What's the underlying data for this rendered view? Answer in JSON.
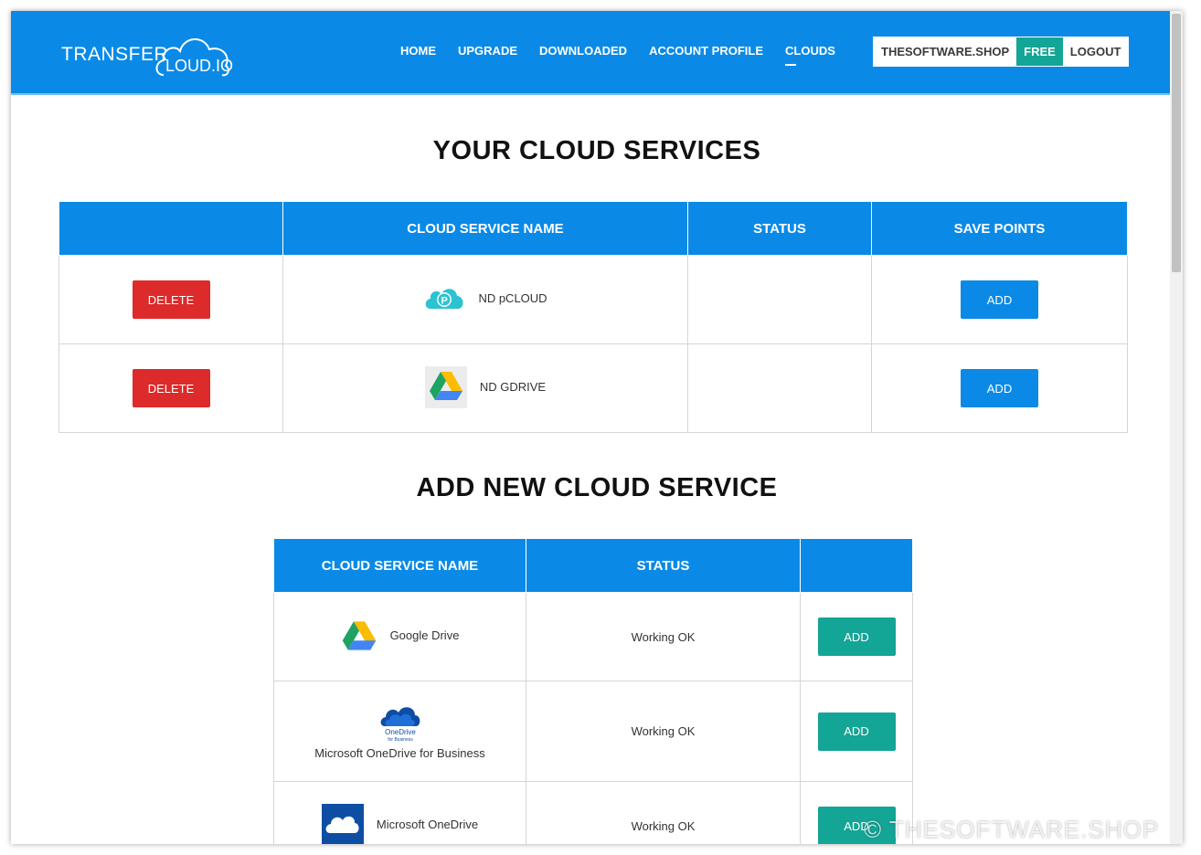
{
  "brand": {
    "logo_text": "TRANSFER",
    "logo_cloud_text": "LOUD.IO"
  },
  "nav": [
    {
      "label": "HOME",
      "active": false
    },
    {
      "label": "UPGRADE",
      "active": false
    },
    {
      "label": "DOWNLOADED",
      "active": false
    },
    {
      "label": "ACCOUNT PROFILE",
      "active": false
    },
    {
      "label": "CLOUDS",
      "active": true
    }
  ],
  "user": {
    "name": "THESOFTWARE.SHOP",
    "plan": "FREE",
    "logout_label": "LOGOUT"
  },
  "your_services": {
    "title": "YOUR CLOUD SERVICES",
    "columns": [
      "",
      "CLOUD SERVICE NAME",
      "STATUS",
      "SAVE POINTS"
    ],
    "rows": [
      {
        "delete_label": "DELETE",
        "name": "ND pCLOUD",
        "icon": "pcloud-icon",
        "status": "",
        "add_label": "ADD"
      },
      {
        "delete_label": "DELETE",
        "name": "ND GDRIVE",
        "icon": "google-drive-icon",
        "status": "",
        "add_label": "ADD"
      }
    ]
  },
  "add_services": {
    "title": "ADD NEW CLOUD SERVICE",
    "columns": [
      "CLOUD SERVICE NAME",
      "STATUS",
      ""
    ],
    "rows": [
      {
        "name": "Google Drive",
        "icon": "google-drive-icon",
        "status": "Working OK",
        "add_label": "ADD"
      },
      {
        "name": "Microsoft OneDrive for Business",
        "icon": "onedrive-business-icon",
        "icon_caption_1": "OneDrive",
        "icon_caption_2": "for Business",
        "status": "Working OK",
        "add_label": "ADD"
      },
      {
        "name": "Microsoft OneDrive",
        "icon": "onedrive-icon",
        "status": "Working OK",
        "add_label": "ADD"
      }
    ]
  },
  "watermark": "© THESOFTWARE.SHOP",
  "colors": {
    "header": "#0a8ae6",
    "delete": "#dd2a2a",
    "add_teal": "#13a595",
    "plan_badge": "#13a595"
  }
}
